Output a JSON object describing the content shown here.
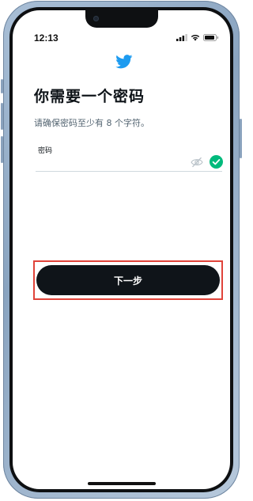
{
  "status_bar": {
    "time": "12:13"
  },
  "header": {
    "logo_icon": "twitter-bird-icon",
    "brand_color": "#1d9bf0"
  },
  "page": {
    "title": "你需要一个密码",
    "subtitle": "请确保密码至少有 8 个字符。"
  },
  "password_field": {
    "label": "密码",
    "value": "",
    "visibility_icon": "eye-slash-icon",
    "valid_icon": "check-circle-icon",
    "valid_color": "#00ba7c"
  },
  "actions": {
    "next_label": "下一步",
    "next_bg": "#0f1419"
  }
}
